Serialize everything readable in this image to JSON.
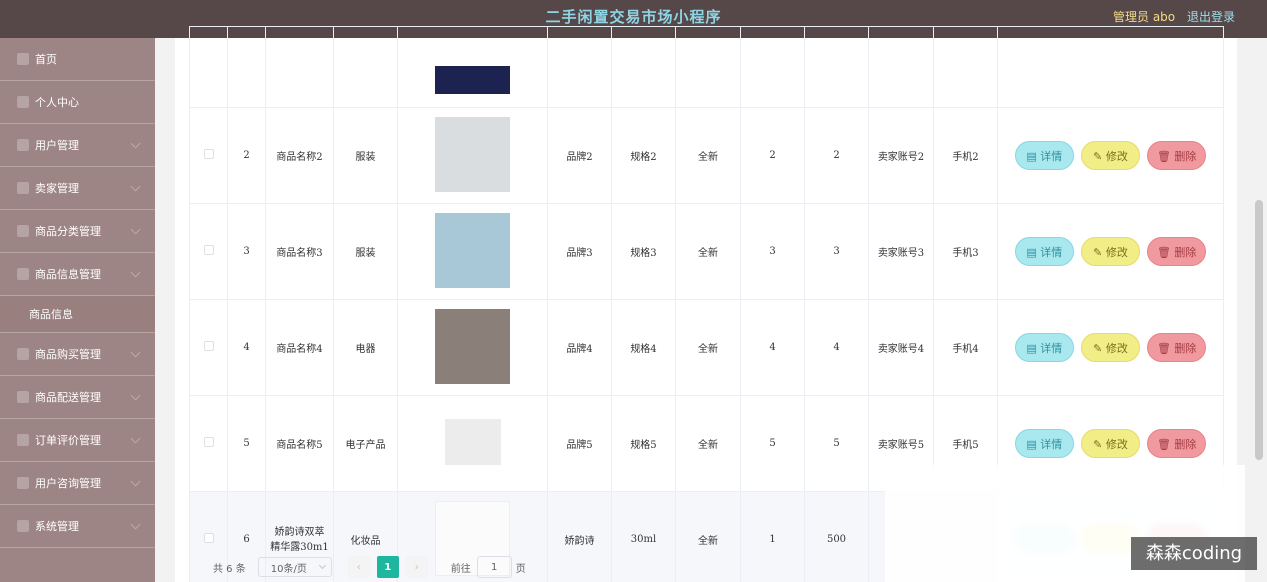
{
  "header": {
    "title": "二手闲置交易市场小程序",
    "admin": "管理员 abo",
    "logout": "退出登录"
  },
  "sidebar": {
    "items": [
      {
        "label": "首页",
        "icon": "home-icon"
      },
      {
        "label": "个人中心",
        "icon": "user-icon"
      },
      {
        "label": "用户管理",
        "icon": "users-icon"
      },
      {
        "label": "卖家管理",
        "icon": "seller-icon"
      },
      {
        "label": "商品分类管理",
        "icon": "category-icon"
      },
      {
        "label": "商品信息管理",
        "icon": "product-icon"
      },
      {
        "label": "商品信息",
        "sub": true
      },
      {
        "label": "商品购买管理",
        "icon": "cart-icon"
      },
      {
        "label": "商品配送管理",
        "icon": "delivery-icon"
      },
      {
        "label": "订单评价管理",
        "icon": "review-icon"
      },
      {
        "label": "用户咨询管理",
        "icon": "chat-icon"
      },
      {
        "label": "系统管理",
        "icon": "settings-icon"
      }
    ]
  },
  "buttons": {
    "detail": "详情",
    "edit": "修改",
    "delete": "删除"
  },
  "rows": [
    {
      "id": "2",
      "name": "商品名称2",
      "category": "服装",
      "brand": "品牌2",
      "spec": "规格2",
      "condition": "全新",
      "a": "2",
      "b": "2",
      "seller": "卖家账号2",
      "phone": "手机2"
    },
    {
      "id": "3",
      "name": "商品名称3",
      "category": "服装",
      "brand": "品牌3",
      "spec": "规格3",
      "condition": "全新",
      "a": "3",
      "b": "3",
      "seller": "卖家账号3",
      "phone": "手机3"
    },
    {
      "id": "4",
      "name": "商品名称4",
      "category": "电器",
      "brand": "品牌4",
      "spec": "规格4",
      "condition": "全新",
      "a": "4",
      "b": "4",
      "seller": "卖家账号4",
      "phone": "手机4"
    },
    {
      "id": "5",
      "name": "商品名称5",
      "category": "电子产品",
      "brand": "品牌5",
      "spec": "规格5",
      "condition": "全新",
      "a": "5",
      "b": "5",
      "seller": "卖家账号5",
      "phone": "手机5"
    },
    {
      "id": "6",
      "name": "娇韵诗双萃精华露30m1",
      "category": "化妆品",
      "brand": "娇韵诗",
      "spec": "30ml",
      "condition": "全新",
      "a": "1",
      "b": "500"
    }
  ],
  "pager": {
    "total": "共 6 条",
    "size": "10条/页",
    "current": "1",
    "goto": "前往",
    "goto_value": "1",
    "page_unit": "页"
  },
  "watermark": "森森coding"
}
